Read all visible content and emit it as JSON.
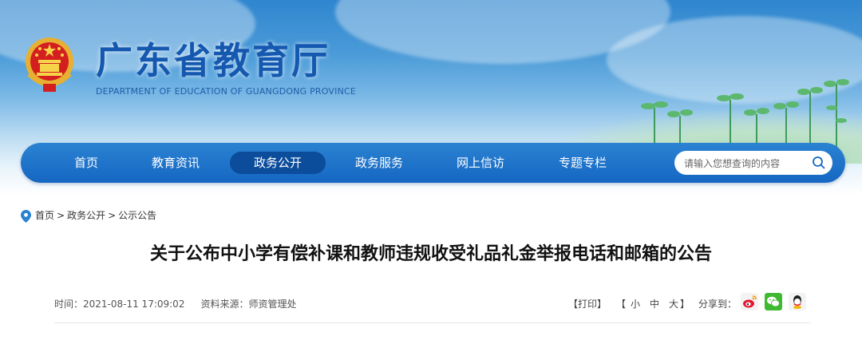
{
  "header": {
    "title_cn": "广东省教育厅",
    "title_en": "DEPARTMENT OF EDUCATION OF GUANGDONG PROVINCE"
  },
  "nav": {
    "items": [
      {
        "label": "首页",
        "active": false
      },
      {
        "label": "教育资讯",
        "active": false
      },
      {
        "label": "政务公开",
        "active": true
      },
      {
        "label": "政务服务",
        "active": false
      },
      {
        "label": "网上信访",
        "active": false
      },
      {
        "label": "专题专栏",
        "active": false
      }
    ],
    "search_placeholder": "请输入您想查询的内容"
  },
  "breadcrumb": {
    "items": [
      "首页",
      "政务公开",
      "公示公告"
    ],
    "separator": ">"
  },
  "article": {
    "title": "关于公布中小学有偿补课和教师违规收受礼品礼金举报电话和邮箱的公告",
    "time": "时间：2021-08-11 17:09:02",
    "source": "资料来源：师资管理处"
  },
  "tools": {
    "print": "【打印】",
    "font_open": "【",
    "font_small": "小",
    "font_medium": "中",
    "font_large": "大",
    "font_close": "】",
    "share_label": "分享到："
  },
  "colors": {
    "nav_bg": "#1567c2",
    "nav_active": "#0b4c9b",
    "title_blue": "#1558b0"
  },
  "icons": [
    "emblem-icon",
    "search-icon",
    "location-pin-icon",
    "weibo-icon",
    "wechat-icon",
    "qq-icon"
  ]
}
